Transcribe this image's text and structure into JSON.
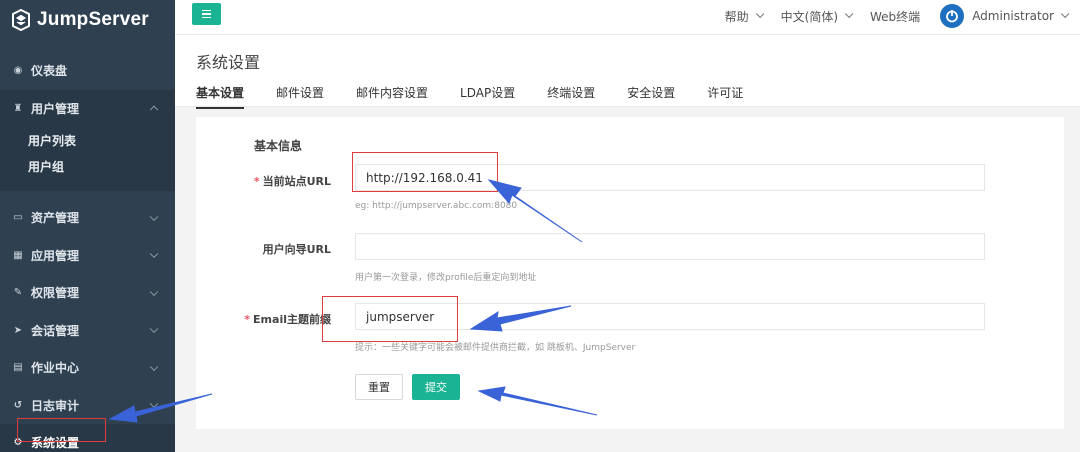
{
  "app": {
    "name": "JumpServer"
  },
  "sidebar": {
    "items": [
      {
        "label": "仪表盘",
        "icon": "dashboard-icon"
      },
      {
        "label": "用户管理",
        "icon": "users-icon",
        "expanded": true
      },
      {
        "label": "资产管理",
        "icon": "laptop-icon"
      },
      {
        "label": "应用管理",
        "icon": "apps-icon"
      },
      {
        "label": "权限管理",
        "icon": "edit-icon"
      },
      {
        "label": "会话管理",
        "icon": "rocket-icon"
      },
      {
        "label": "作业中心",
        "icon": "job-icon"
      },
      {
        "label": "日志审计",
        "icon": "history-icon"
      },
      {
        "label": "系统设置",
        "icon": "gears-icon",
        "active": true
      }
    ],
    "user_sub": [
      "用户列表",
      "用户组"
    ]
  },
  "topbar": {
    "help": "帮助",
    "language": "中文(简体)",
    "web_terminal": "Web终端",
    "user": "Administrator"
  },
  "page": {
    "title": "系统设置",
    "tabs": [
      "基本设置",
      "邮件设置",
      "邮件内容设置",
      "LDAP设置",
      "终端设置",
      "安全设置",
      "许可证"
    ],
    "active_tab": "基本设置"
  },
  "form": {
    "section_title": "基本信息",
    "site_url": {
      "label": "当前站点URL",
      "required": "*",
      "value": "http://192.168.0.41",
      "hint": "eg: http://jumpserver.abc.com:8080"
    },
    "guide_url": {
      "label": "用户向导URL",
      "value": "",
      "hint": "用户第一次登录，修改profile后重定向到地址"
    },
    "email_prefix": {
      "label": "Email主题前缀",
      "required": "*",
      "value": "jumpserver",
      "hint": "提示：一些关键字可能会被邮件提供商拦截，如 跳板机、JumpServer"
    },
    "reset_label": "重置",
    "submit_label": "提交"
  },
  "colors": {
    "sidebar_bg": "#2f4050",
    "accent": "#1ab394",
    "annotation_red": "#e03c3c",
    "annotation_arrow": "#3a63d8"
  }
}
